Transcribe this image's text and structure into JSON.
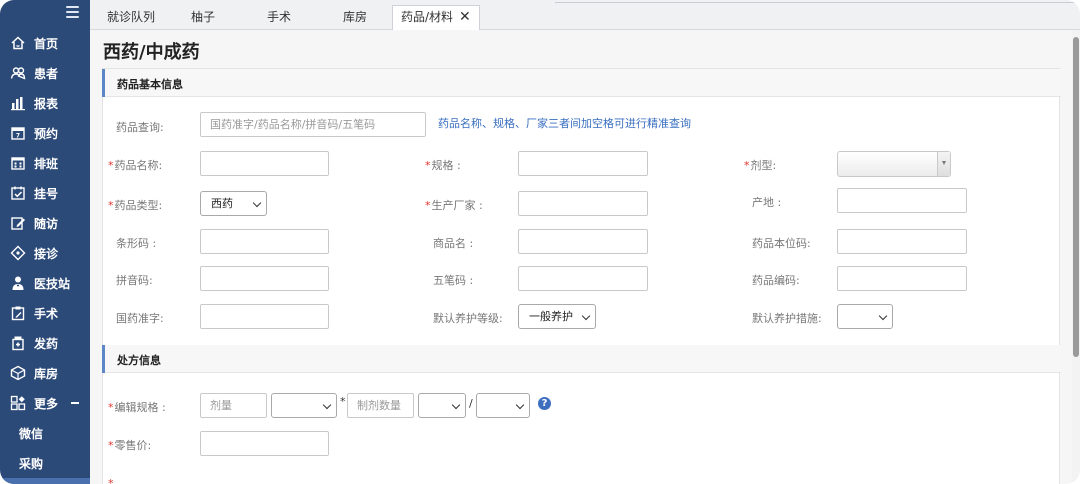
{
  "sidebar": {
    "items": [
      {
        "label": "首页",
        "icon": "home-icon"
      },
      {
        "label": "患者",
        "icon": "users-icon"
      },
      {
        "label": "报表",
        "icon": "bar-chart-icon"
      },
      {
        "label": "预约",
        "icon": "calendar-day-icon"
      },
      {
        "label": "排班",
        "icon": "calendar-grid-icon"
      },
      {
        "label": "挂号",
        "icon": "calendar-check-icon"
      },
      {
        "label": "随访",
        "icon": "edit-icon"
      },
      {
        "label": "接诊",
        "icon": "compass-icon"
      },
      {
        "label": "医技站",
        "icon": "doctor-icon"
      },
      {
        "label": "手术",
        "icon": "clipboard-edit-icon"
      },
      {
        "label": "发药",
        "icon": "medicine-box-icon"
      },
      {
        "label": "库房",
        "icon": "warehouse-icon"
      },
      {
        "label": "更多",
        "icon": "apps-icon"
      }
    ],
    "subitems": [
      "微信",
      "采购"
    ]
  },
  "tabs": [
    "就诊队列",
    "柚子",
    "手术",
    "库房",
    "药品/材料"
  ],
  "page_title": "西药/中成药",
  "sections": {
    "basic": "药品基本信息",
    "prescription": "处方信息"
  },
  "form": {
    "query_label": "药品查询:",
    "query_placeholder": "国药准字/药品名称/拼音码/五笔码",
    "query_hint": "药品名称、规格、厂家三者间加空格可进行精准查询",
    "name_label": "药品名称:",
    "spec_label": "规格 :",
    "dosage_form_label": "剂型:",
    "type_label": "药品类型:",
    "type_value": "西药",
    "manufacturer_label": "生产厂家 :",
    "origin_label": "产地 :",
    "barcode_label": "条形码 :",
    "trade_name_label": "商品名 :",
    "internal_code_label": "药品本位码:",
    "pinyin_label": "拼音码:",
    "wubi_label": "五笔码 :",
    "drug_code_label": "药品编码:",
    "approval_label": "国药准字:",
    "maintenance_level_label": "默认养护等级:",
    "maintenance_level_value": "一般养护",
    "maintenance_measure_label": "默认养护措施:",
    "maintenance_measure_value": "",
    "edit_spec_label": "编辑规格 :",
    "dose_placeholder": "剂量",
    "prep_qty_placeholder": "制剂数量",
    "times": "*",
    "slash": "/",
    "help": "?",
    "retail_price_label": "零售价:"
  },
  "colors": {
    "sidebar": "#2c4a78",
    "required": "#d9342b",
    "link": "#3a6fc0",
    "section_bar": "#5d86c7"
  }
}
